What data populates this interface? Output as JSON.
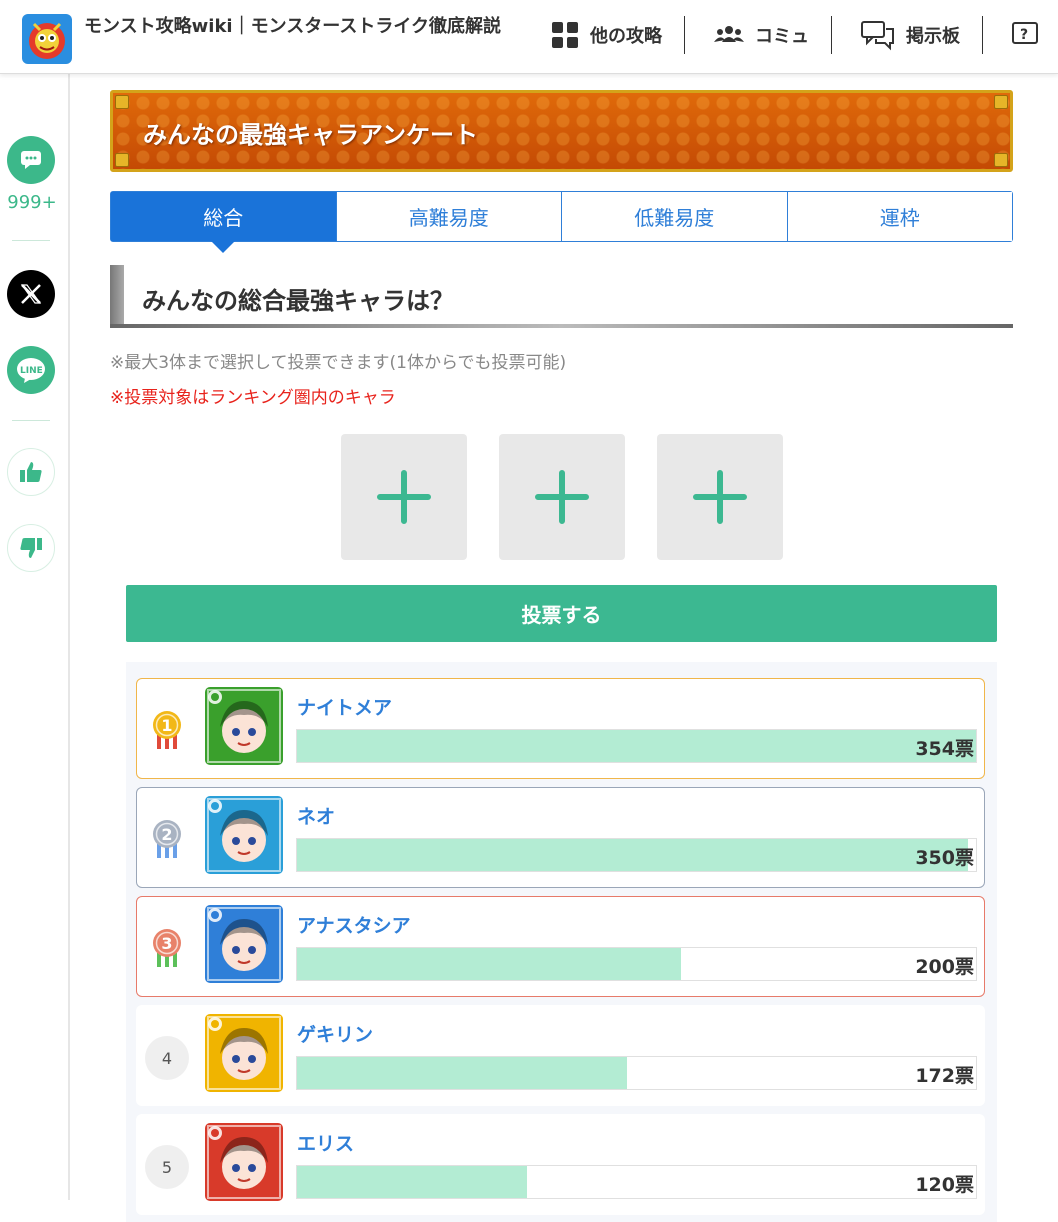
{
  "header": {
    "site_title": "モンスト攻略wiki｜モンスターストライク徹底解説",
    "nav": [
      {
        "icon": "grid-icon",
        "label": "他の攻略"
      },
      {
        "icon": "users-icon",
        "label": "コミュ"
      },
      {
        "icon": "chat-icon",
        "label": "掲示板"
      }
    ]
  },
  "rail": {
    "comment_count": "999+"
  },
  "banner": {
    "title": "みんなの最強キャラアンケート"
  },
  "tabs": [
    "総合",
    "高難易度",
    "低難易度",
    "運枠"
  ],
  "active_tab": 0,
  "question": "みんなの総合最強キャラは？",
  "notes": {
    "gray": "※最大3体まで選択して投票できます(1体からでも投票可能)",
    "red": "※投票対象はランキング圏内のキャラ"
  },
  "vote_button": "投票する",
  "ranking": [
    {
      "rank": "1",
      "name": "ナイトメア",
      "votes": "354票",
      "value": 354,
      "medal": "gold"
    },
    {
      "rank": "2",
      "name": "ネオ",
      "votes": "350票",
      "value": 350,
      "medal": "silver"
    },
    {
      "rank": "3",
      "name": "アナスタシア",
      "votes": "200票",
      "value": 200,
      "medal": "bronze"
    },
    {
      "rank": "4",
      "name": "ゲキリン",
      "votes": "172票",
      "value": 172,
      "medal": ""
    },
    {
      "rank": "5",
      "name": "エリス",
      "votes": "120票",
      "value": 120,
      "medal": ""
    }
  ],
  "colors": {
    "accent_green": "#3cb891",
    "tab_blue": "#1a73d9",
    "bar_fill": "#b3ecd3",
    "name_blue": "#2f7fd8",
    "note_red": "#e8231c",
    "avatar_bgs": [
      "#3aa02c",
      "#2a9fd8",
      "#2f7fd8",
      "#f0b400",
      "#d83a2a"
    ]
  }
}
